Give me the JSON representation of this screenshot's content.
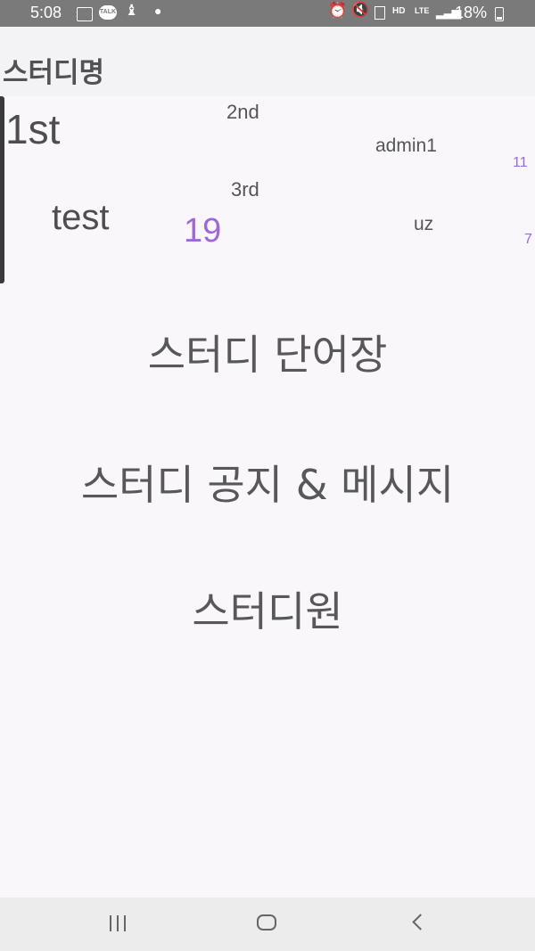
{
  "status_bar": {
    "time": "5:08",
    "battery": "18%",
    "icons": [
      "screenshot-icon",
      "kakaotalk-icon",
      "notification-icon",
      "dot-icon",
      "alarm-icon",
      "mute-icon",
      "battery-saver-icon",
      "hd-voice-icon",
      "lte-icon",
      "signal-icon",
      "battery-icon"
    ],
    "talk_label": "TALK",
    "hd_label": "HD",
    "lte_label": "LTE"
  },
  "app_bar": {
    "title": "스터디명"
  },
  "ranking": {
    "ranks": [
      "1st",
      "2nd",
      "3rd"
    ],
    "names": [
      "test",
      "admin1",
      "uz"
    ],
    "scores": [
      "19",
      "11",
      "7"
    ]
  },
  "menu": {
    "vocabulary": "스터디 단어장",
    "notice_message": "스터디 공지 & 메시지",
    "members": "스터디원"
  },
  "nav_bar": {
    "icons": [
      "recent-apps-icon",
      "home-icon",
      "back-icon"
    ]
  },
  "colors": {
    "status_bar_bg": "#7a7a7a",
    "accent_purple": "#9f67d8",
    "text_gray": "#545357",
    "background": "#f9f7fa"
  }
}
